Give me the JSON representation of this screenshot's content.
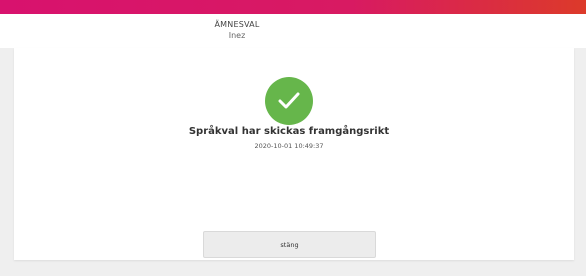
{
  "header": {
    "title": "ÄMNESVAL",
    "subtitle": "Inez"
  },
  "confirmation": {
    "icon": "check-icon",
    "message": "Språkval har skickas framgångsrikt",
    "timestamp": "2020-10-01 10:49:37"
  },
  "actions": {
    "close_label": "stäng"
  },
  "colors": {
    "accent_gradient_start": "#d8126e",
    "accent_gradient_end": "#dc3a2a",
    "success": "#66b64b"
  }
}
